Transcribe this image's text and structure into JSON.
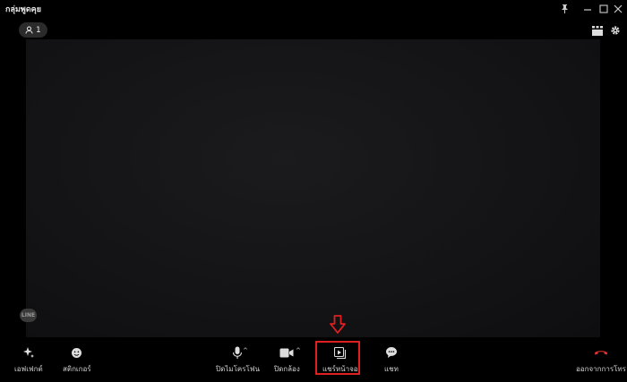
{
  "window": {
    "title": "กลุ่มพูดคุย"
  },
  "participants": {
    "count": "1"
  },
  "video": {
    "badge": "LINE"
  },
  "toolbar": {
    "effects": "เอฟเฟกต์",
    "stickers": "สติกเกอร์",
    "mic": "ปิดไมโครโฟน",
    "camera": "ปิดกล้อง",
    "share": "แชร์หน้าจอ",
    "chat": "แชท",
    "leave": "ออกจากการโทร"
  },
  "colors": {
    "highlight": "#e02020",
    "leave_icon": "#e03030"
  }
}
